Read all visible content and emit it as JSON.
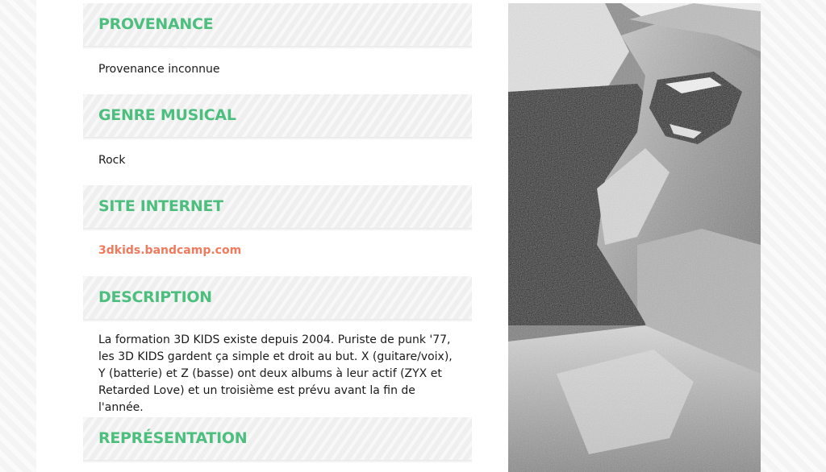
{
  "sections": {
    "provenance": {
      "title": "PROVENANCE",
      "value": "Provenance inconnue"
    },
    "genre": {
      "title": "GENRE MUSICAL",
      "value": "Rock"
    },
    "website": {
      "title": "SITE INTERNET",
      "link_text": "3dkids.bandcamp.com"
    },
    "description": {
      "title": "DESCRIPTION",
      "text": "La formation 3D KIDS existe depuis 2004. Puriste de punk '77, les 3D KIDS gardent ça simple et droit au but. X (guitare/voix), Y (batterie) et Z (basse) ont deux albums à leur actif (ZYX et Retarded Love) et un troisième est prévu avant la fin de l'année."
    },
    "representation": {
      "title": "REPRÉSENTATION"
    }
  },
  "colors": {
    "heading_green": "#4cbf7f",
    "link_coral": "#f07a5e",
    "text": "#1a1a1a"
  },
  "photo": {
    "icon": "band-photo"
  }
}
